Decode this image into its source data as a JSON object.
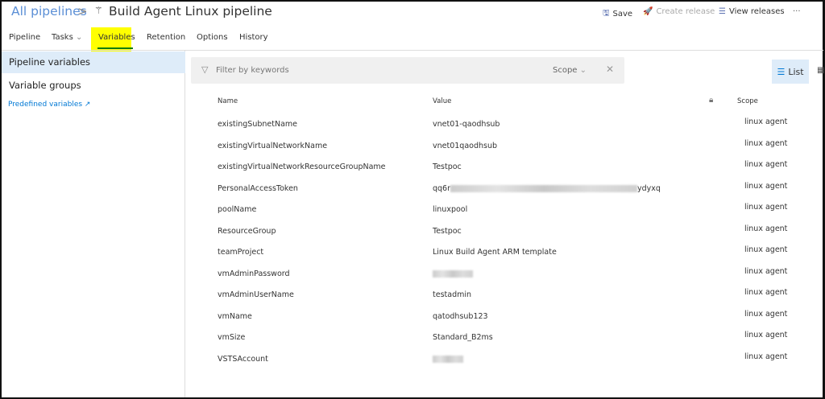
{
  "header": {
    "breadcrumb": "All pipelines",
    "separator": ">",
    "pipeline_icon": "pipeline-icon",
    "title": "Build Agent Linux pipeline"
  },
  "toolbar": {
    "save": "Save",
    "create_release": "Create release",
    "view_releases": "View releases",
    "more": "···"
  },
  "tabs": [
    {
      "label": "Pipeline"
    },
    {
      "label": "Tasks"
    },
    {
      "label": "Variables",
      "selected": true
    },
    {
      "label": "Retention"
    },
    {
      "label": "Options"
    },
    {
      "label": "History"
    }
  ],
  "sidebar": {
    "items": [
      {
        "label": "Pipeline variables",
        "selected": true
      },
      {
        "label": "Variable groups"
      }
    ],
    "link": "Predefined variables"
  },
  "filter": {
    "placeholder": "Filter by keywords",
    "scope": "Scope"
  },
  "view": {
    "list": "List"
  },
  "table": {
    "columns": {
      "name": "Name",
      "value": "Value",
      "scope": "Scope"
    },
    "rows": [
      {
        "name": "existingSubnetName",
        "value": "vnet01-qaodhsub",
        "scope": "linux agent"
      },
      {
        "name": "existingVirtualNetworkName",
        "value": "vnet01qaodhsub",
        "scope": "linux agent"
      },
      {
        "name": "existingVirtualNetworkResourceGroupName",
        "value": "Testpoc",
        "scope": "linux agent"
      },
      {
        "name": "PersonalAccessToken",
        "value": "qq6r",
        "value_suffix": "ydyxq",
        "blurred": true,
        "scope": "linux agent"
      },
      {
        "name": "poolName",
        "value": "linuxpool",
        "scope": "linux agent"
      },
      {
        "name": "ResourceGroup",
        "value": "Testpoc",
        "scope": "linux agent"
      },
      {
        "name": "teamProject",
        "value": "Linux Build Agent ARM template",
        "scope": "linux agent"
      },
      {
        "name": "vmAdminPassword",
        "value": "",
        "blurred": true,
        "scope": "linux agent"
      },
      {
        "name": "vmAdminUserName",
        "value": "testadmin",
        "scope": "linux agent"
      },
      {
        "name": "vmName",
        "value": "qatodhsub123",
        "scope": "linux agent"
      },
      {
        "name": "vmSize",
        "value": "Standard_B2ms",
        "scope": "linux agent"
      },
      {
        "name": "VSTSAccount",
        "value": "",
        "blurred": true,
        "scope": "linux agent"
      }
    ]
  },
  "colors": {
    "accent": "#0078d4",
    "selected_bg": "#deecf9",
    "tab_underline": "#107c10",
    "highlight": "#ffff00"
  }
}
